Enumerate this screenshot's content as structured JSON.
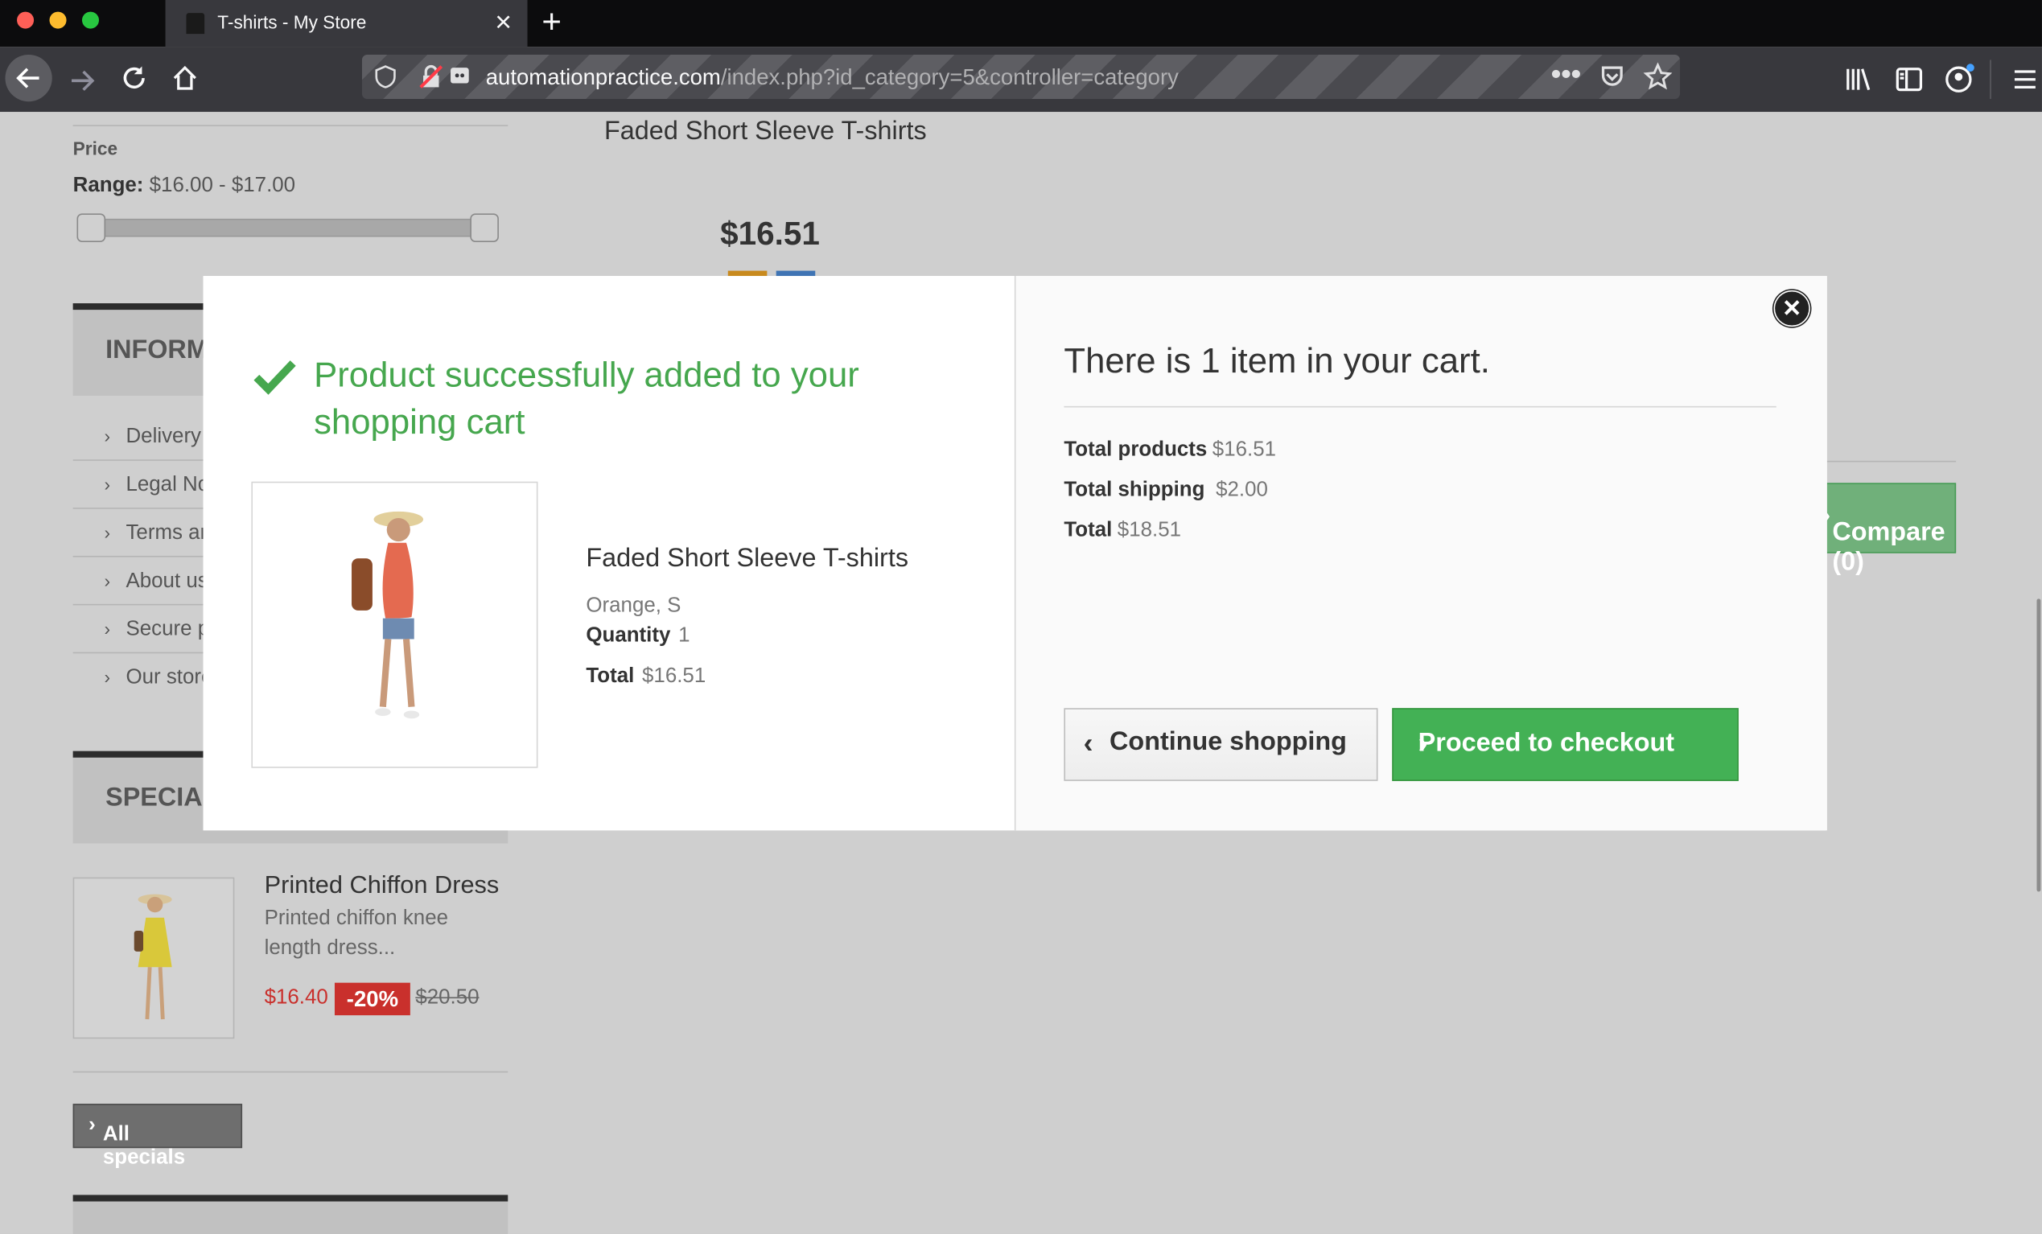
{
  "browser": {
    "tab_title": "T-shirts - My Store",
    "url_domain": "automationpractice.com",
    "url_path": "/index.php?id_category=5&controller=category",
    "new_tab_icon": "plus-icon",
    "close_tab_icon": "close-icon"
  },
  "sidebar": {
    "price_heading": "Price",
    "range_label": "Range:",
    "range_value": "$16.00 - $17.00",
    "information_title": "INFORMATION",
    "information_items": [
      "Delivery",
      "Legal Notice",
      "Terms and conditions of use",
      "About us",
      "Secure payment",
      "Our stores"
    ],
    "specials_title": "SPECIALS",
    "special": {
      "name": "Printed Chiffon Dress",
      "description": "Printed chiffon knee length dress...",
      "price": "$16.40",
      "discount": "-20%",
      "old_price": "$20.50"
    },
    "all_specials": "All specials"
  },
  "main": {
    "product_title": "Faded Short Sleeve T-shirts",
    "product_price": "$16.51",
    "compare_label": "Compare (0)"
  },
  "modal": {
    "success_message": "Product successfully added to your shopping cart",
    "product": {
      "name": "Faded Short Sleeve T-shirts",
      "attributes": "Orange, S",
      "quantity_label": "Quantity",
      "quantity_value": "1",
      "total_label": "Total",
      "total_value": "$16.51"
    },
    "cart": {
      "title": "There is 1 item in your cart.",
      "total_products_label": "Total products",
      "total_products_value": "$16.51",
      "total_shipping_label": "Total shipping",
      "total_shipping_value": "$2.00",
      "total_label": "Total",
      "total_value": "$18.51"
    },
    "continue_label": "Continue shopping",
    "checkout_label": "Proceed to checkout"
  },
  "colors": {
    "success_green": "#46a74e",
    "checkout_green": "#43b155",
    "discount_red": "#c9302c"
  }
}
